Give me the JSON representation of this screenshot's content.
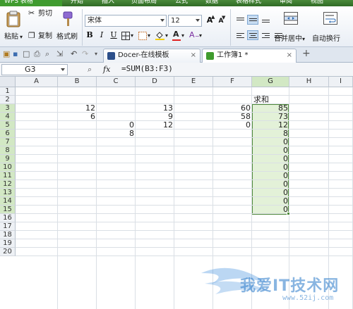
{
  "menu": {
    "app_label": "WPS 表格",
    "items": [
      "开始",
      "插入",
      "页面布局",
      "公式",
      "数据",
      "表格样式",
      "审阅",
      "视图"
    ]
  },
  "ribbon": {
    "paste_label": "粘贴",
    "cut_label": "剪切",
    "copy_label": "复制",
    "format_painter_label": "格式刷",
    "font_name": "宋体",
    "font_size": "12",
    "bold": "B",
    "italic": "I",
    "underline": "U",
    "grow_font": "A",
    "shrink_font": "A",
    "font_color_glyph": "A",
    "merge_center_label": "合并居中",
    "wrap_text_label": "自动换行"
  },
  "tabs": [
    {
      "label": "Docer-在线模板",
      "closable": true
    },
    {
      "label": "工作簿1 *",
      "closable": true
    }
  ],
  "new_tab_glyph": "+",
  "formula_bar": {
    "name_box": "G3",
    "fx": "fx",
    "formula": "=SUM(B3:F3)"
  },
  "sheet": {
    "columns": [
      "A",
      "B",
      "C",
      "D",
      "E",
      "F",
      "G",
      "H",
      "I"
    ],
    "selected_column": "G",
    "rows": [
      "1",
      "2",
      "3",
      "4",
      "5",
      "6",
      "7",
      "8",
      "9",
      "10",
      "11",
      "12",
      "13",
      "14",
      "15",
      "16",
      "17",
      "18",
      "19",
      "20"
    ],
    "selected_rows": [
      "3",
      "4",
      "5",
      "6",
      "7",
      "8",
      "9",
      "10",
      "11",
      "12",
      "13",
      "14",
      "15"
    ],
    "cells": {
      "G2": "求和",
      "B3": "12",
      "D3": "13",
      "F3": "60",
      "G3": "85",
      "B4": "6",
      "D4": "9",
      "F4": "58",
      "G4": "73",
      "C5": "0",
      "D5": "12",
      "F5": "0",
      "G5": "12",
      "C6": "8",
      "G6": "8",
      "G7": "0",
      "G8": "0",
      "G9": "0",
      "G10": "0",
      "G11": "0",
      "G12": "0",
      "G13": "0",
      "G14": "0",
      "G15": "0"
    }
  },
  "watermark": {
    "text": "我爱IT技术网",
    "url": "www.52ij.com"
  },
  "colors": {
    "menubar": "#2f6b25",
    "selection_fill": "#e3f1d8",
    "selection_border": "#4f8a3b",
    "header_selected": "#d2e8c4"
  }
}
